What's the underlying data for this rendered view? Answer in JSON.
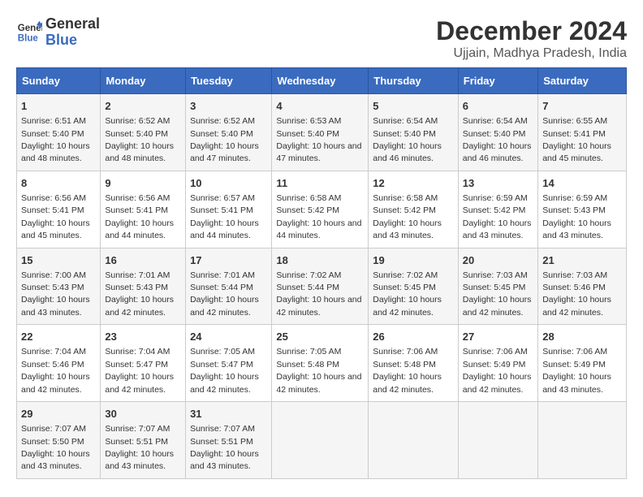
{
  "logo": {
    "line1": "General",
    "line2": "Blue"
  },
  "title": "December 2024",
  "subtitle": "Ujjain, Madhya Pradesh, India",
  "days_of_week": [
    "Sunday",
    "Monday",
    "Tuesday",
    "Wednesday",
    "Thursday",
    "Friday",
    "Saturday"
  ],
  "weeks": [
    [
      {
        "day": "1",
        "sunrise": "Sunrise: 6:51 AM",
        "sunset": "Sunset: 5:40 PM",
        "daylight": "Daylight: 10 hours and 48 minutes."
      },
      {
        "day": "2",
        "sunrise": "Sunrise: 6:52 AM",
        "sunset": "Sunset: 5:40 PM",
        "daylight": "Daylight: 10 hours and 48 minutes."
      },
      {
        "day": "3",
        "sunrise": "Sunrise: 6:52 AM",
        "sunset": "Sunset: 5:40 PM",
        "daylight": "Daylight: 10 hours and 47 minutes."
      },
      {
        "day": "4",
        "sunrise": "Sunrise: 6:53 AM",
        "sunset": "Sunset: 5:40 PM",
        "daylight": "Daylight: 10 hours and 47 minutes."
      },
      {
        "day": "5",
        "sunrise": "Sunrise: 6:54 AM",
        "sunset": "Sunset: 5:40 PM",
        "daylight": "Daylight: 10 hours and 46 minutes."
      },
      {
        "day": "6",
        "sunrise": "Sunrise: 6:54 AM",
        "sunset": "Sunset: 5:40 PM",
        "daylight": "Daylight: 10 hours and 46 minutes."
      },
      {
        "day": "7",
        "sunrise": "Sunrise: 6:55 AM",
        "sunset": "Sunset: 5:41 PM",
        "daylight": "Daylight: 10 hours and 45 minutes."
      }
    ],
    [
      {
        "day": "8",
        "sunrise": "Sunrise: 6:56 AM",
        "sunset": "Sunset: 5:41 PM",
        "daylight": "Daylight: 10 hours and 45 minutes."
      },
      {
        "day": "9",
        "sunrise": "Sunrise: 6:56 AM",
        "sunset": "Sunset: 5:41 PM",
        "daylight": "Daylight: 10 hours and 44 minutes."
      },
      {
        "day": "10",
        "sunrise": "Sunrise: 6:57 AM",
        "sunset": "Sunset: 5:41 PM",
        "daylight": "Daylight: 10 hours and 44 minutes."
      },
      {
        "day": "11",
        "sunrise": "Sunrise: 6:58 AM",
        "sunset": "Sunset: 5:42 PM",
        "daylight": "Daylight: 10 hours and 44 minutes."
      },
      {
        "day": "12",
        "sunrise": "Sunrise: 6:58 AM",
        "sunset": "Sunset: 5:42 PM",
        "daylight": "Daylight: 10 hours and 43 minutes."
      },
      {
        "day": "13",
        "sunrise": "Sunrise: 6:59 AM",
        "sunset": "Sunset: 5:42 PM",
        "daylight": "Daylight: 10 hours and 43 minutes."
      },
      {
        "day": "14",
        "sunrise": "Sunrise: 6:59 AM",
        "sunset": "Sunset: 5:43 PM",
        "daylight": "Daylight: 10 hours and 43 minutes."
      }
    ],
    [
      {
        "day": "15",
        "sunrise": "Sunrise: 7:00 AM",
        "sunset": "Sunset: 5:43 PM",
        "daylight": "Daylight: 10 hours and 43 minutes."
      },
      {
        "day": "16",
        "sunrise": "Sunrise: 7:01 AM",
        "sunset": "Sunset: 5:43 PM",
        "daylight": "Daylight: 10 hours and 42 minutes."
      },
      {
        "day": "17",
        "sunrise": "Sunrise: 7:01 AM",
        "sunset": "Sunset: 5:44 PM",
        "daylight": "Daylight: 10 hours and 42 minutes."
      },
      {
        "day": "18",
        "sunrise": "Sunrise: 7:02 AM",
        "sunset": "Sunset: 5:44 PM",
        "daylight": "Daylight: 10 hours and 42 minutes."
      },
      {
        "day": "19",
        "sunrise": "Sunrise: 7:02 AM",
        "sunset": "Sunset: 5:45 PM",
        "daylight": "Daylight: 10 hours and 42 minutes."
      },
      {
        "day": "20",
        "sunrise": "Sunrise: 7:03 AM",
        "sunset": "Sunset: 5:45 PM",
        "daylight": "Daylight: 10 hours and 42 minutes."
      },
      {
        "day": "21",
        "sunrise": "Sunrise: 7:03 AM",
        "sunset": "Sunset: 5:46 PM",
        "daylight": "Daylight: 10 hours and 42 minutes."
      }
    ],
    [
      {
        "day": "22",
        "sunrise": "Sunrise: 7:04 AM",
        "sunset": "Sunset: 5:46 PM",
        "daylight": "Daylight: 10 hours and 42 minutes."
      },
      {
        "day": "23",
        "sunrise": "Sunrise: 7:04 AM",
        "sunset": "Sunset: 5:47 PM",
        "daylight": "Daylight: 10 hours and 42 minutes."
      },
      {
        "day": "24",
        "sunrise": "Sunrise: 7:05 AM",
        "sunset": "Sunset: 5:47 PM",
        "daylight": "Daylight: 10 hours and 42 minutes."
      },
      {
        "day": "25",
        "sunrise": "Sunrise: 7:05 AM",
        "sunset": "Sunset: 5:48 PM",
        "daylight": "Daylight: 10 hours and 42 minutes."
      },
      {
        "day": "26",
        "sunrise": "Sunrise: 7:06 AM",
        "sunset": "Sunset: 5:48 PM",
        "daylight": "Daylight: 10 hours and 42 minutes."
      },
      {
        "day": "27",
        "sunrise": "Sunrise: 7:06 AM",
        "sunset": "Sunset: 5:49 PM",
        "daylight": "Daylight: 10 hours and 42 minutes."
      },
      {
        "day": "28",
        "sunrise": "Sunrise: 7:06 AM",
        "sunset": "Sunset: 5:49 PM",
        "daylight": "Daylight: 10 hours and 43 minutes."
      }
    ],
    [
      {
        "day": "29",
        "sunrise": "Sunrise: 7:07 AM",
        "sunset": "Sunset: 5:50 PM",
        "daylight": "Daylight: 10 hours and 43 minutes."
      },
      {
        "day": "30",
        "sunrise": "Sunrise: 7:07 AM",
        "sunset": "Sunset: 5:51 PM",
        "daylight": "Daylight: 10 hours and 43 minutes."
      },
      {
        "day": "31",
        "sunrise": "Sunrise: 7:07 AM",
        "sunset": "Sunset: 5:51 PM",
        "daylight": "Daylight: 10 hours and 43 minutes."
      },
      null,
      null,
      null,
      null
    ]
  ]
}
